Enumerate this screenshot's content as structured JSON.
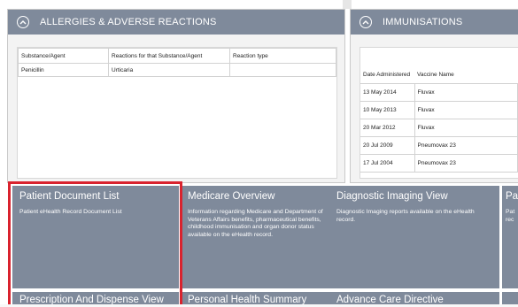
{
  "allergies": {
    "title": "ALLERGIES & ADVERSE REACTIONS",
    "columns": [
      "Substance/Agent",
      "Reactions for that Substance/Agent",
      "Reaction type"
    ],
    "rows": [
      [
        "Penicillin",
        "Urticaria",
        ""
      ]
    ]
  },
  "immunisations": {
    "title": "IMMUNISATIONS",
    "columns": [
      "Date Administered",
      "Vaccine Name"
    ],
    "rows": [
      [
        "13 May 2014",
        "Fluvax"
      ],
      [
        "10 May 2013",
        "Fluvax"
      ],
      [
        "20 Mar 2012",
        "Fluvax"
      ],
      [
        "20 Jul 2009",
        "Pneumovax 23"
      ],
      [
        "17 Jul 2004",
        "Pneumovax 23"
      ]
    ]
  },
  "tiles": [
    {
      "title": "Patient Document List",
      "desc": "Patient eHealth Record Document List"
    },
    {
      "title": "Medicare Overview",
      "desc": "Information regarding Medicare and Department of Veterans Affairs benefits, pharmaceutical benefits, childhood immunisation and organ donor status available on the eHealth record."
    },
    {
      "title": "Diagnostic Imaging View",
      "desc": "Diagnostic Imaging reports available on the eHealth record."
    },
    {
      "title": "Pa",
      "desc": "Pat rec"
    },
    {
      "title": "Prescription And Dispense View",
      "desc": ""
    },
    {
      "title": "Personal Health Summary",
      "desc": ""
    },
    {
      "title": "Advance Care Directive",
      "desc": ""
    }
  ],
  "colors": {
    "tile": "#7f8a9b",
    "highlight": "#d9232e",
    "panel_bg": "#f3f3f3"
  },
  "icons": [
    "chevron-up-icon"
  ]
}
